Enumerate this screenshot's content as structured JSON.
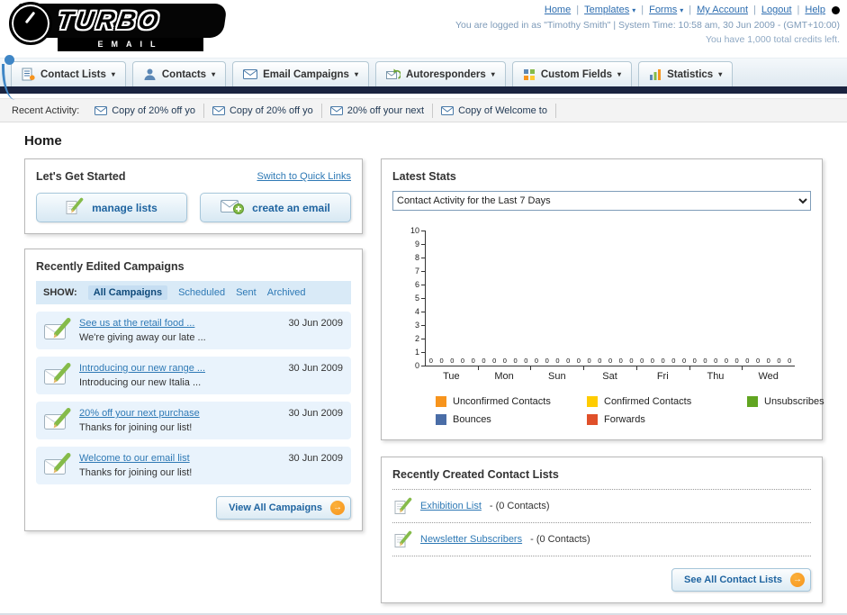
{
  "icons": {
    "chevron_down": "▾",
    "arrow_right": "→",
    "separator": "|"
  },
  "header": {
    "logo": {
      "title": "TURBO",
      "subtitle": "EMAIL"
    },
    "nav": [
      {
        "label": "Home",
        "dropdown": false
      },
      {
        "label": "Templates",
        "dropdown": true
      },
      {
        "label": "Forms",
        "dropdown": true
      },
      {
        "label": "My Account",
        "dropdown": false
      },
      {
        "label": "Logout",
        "dropdown": false
      },
      {
        "label": "Help",
        "dropdown": false
      }
    ],
    "login_status": "You are logged in as \"Timothy Smith\" | System Time: 10:58 am, 30 Jun 2009 - (GMT+10:00)",
    "credits": "You have 1,000 total credits left."
  },
  "main_nav": {
    "tabs": [
      {
        "label": "Contact Lists",
        "icon": "contact-lists-icon"
      },
      {
        "label": "Contacts",
        "icon": "contacts-icon"
      },
      {
        "label": "Email Campaigns",
        "icon": "email-campaigns-icon"
      },
      {
        "label": "Autoresponders",
        "icon": "autoresponders-icon"
      },
      {
        "label": "Custom Fields",
        "icon": "custom-fields-icon"
      },
      {
        "label": "Statistics",
        "icon": "statistics-icon"
      }
    ]
  },
  "recent_activity": {
    "label": "Recent Activity:",
    "items": [
      "Copy of 20% off yo",
      "Copy of 20% off yo",
      "20% off your next",
      "Copy of Welcome to"
    ]
  },
  "page": {
    "title": "Home"
  },
  "get_started": {
    "title": "Let's Get Started",
    "switch_link": "Switch to Quick Links",
    "manage_lists_button": "manage lists",
    "create_email_button": "create an email"
  },
  "campaigns": {
    "title": "Recently Edited Campaigns",
    "show_label": "SHOW:",
    "tabs": [
      "All Campaigns",
      "Scheduled",
      "Sent",
      "Archived"
    ],
    "active_tab": "All Campaigns",
    "items": [
      {
        "title": "See us at the retail food ...",
        "subtitle": "We're giving away our late ...",
        "date": "30 Jun 2009"
      },
      {
        "title": "Introducing our new range ...",
        "subtitle": "Introducing our new Italia ...",
        "date": "30 Jun 2009"
      },
      {
        "title": "20% off your next purchase",
        "subtitle": "Thanks for joining our list!",
        "date": "30 Jun 2009"
      },
      {
        "title": "Welcome to our email list",
        "subtitle": "Thanks for joining our list!",
        "date": "30 Jun 2009"
      }
    ],
    "view_all_button": "View All Campaigns"
  },
  "stats": {
    "title": "Latest Stats",
    "period_select": "Contact Activity for the Last 7 Days",
    "chart_data": {
      "type": "bar",
      "title": "Contact Activity for the Last 7 Days",
      "categories": [
        "Tue",
        "Mon",
        "Sun",
        "Sat",
        "Fri",
        "Thu",
        "Wed"
      ],
      "series": [
        {
          "name": "Unconfirmed Contacts",
          "color": "#f7941d",
          "values": [
            0,
            0,
            0,
            0,
            0,
            0,
            0
          ]
        },
        {
          "name": "Confirmed Contacts",
          "color": "#ffcc00",
          "values": [
            0,
            0,
            0,
            0,
            0,
            0,
            0
          ]
        },
        {
          "name": "Unsubscribes",
          "color": "#61a521",
          "values": [
            0,
            0,
            0,
            0,
            0,
            0,
            0
          ]
        },
        {
          "name": "Bounces",
          "color": "#4a6da7",
          "values": [
            0,
            0,
            0,
            0,
            0,
            0,
            0
          ]
        },
        {
          "name": "Forwards",
          "color": "#e0502a",
          "values": [
            0,
            0,
            0,
            0,
            0,
            0,
            0
          ]
        }
      ],
      "ylim": [
        0,
        10
      ],
      "y_ticks": [
        0,
        1,
        2,
        3,
        4,
        5,
        6,
        7,
        8,
        9,
        10
      ],
      "grid": false,
      "legend_position": "bottom",
      "value_labels_shown": true
    }
  },
  "contact_lists": {
    "title": "Recently Created Contact Lists",
    "items": [
      {
        "name": "Exhibition List",
        "detail": "- (0 Contacts)"
      },
      {
        "name": "Newsletter Subscribers",
        "detail": "- (0 Contacts)"
      }
    ],
    "see_all_button": "See All Contact Lists"
  },
  "colors": {
    "accent_blue": "#2e79b5",
    "navy_bar": "#1a2440",
    "orange": "#f7941d"
  }
}
